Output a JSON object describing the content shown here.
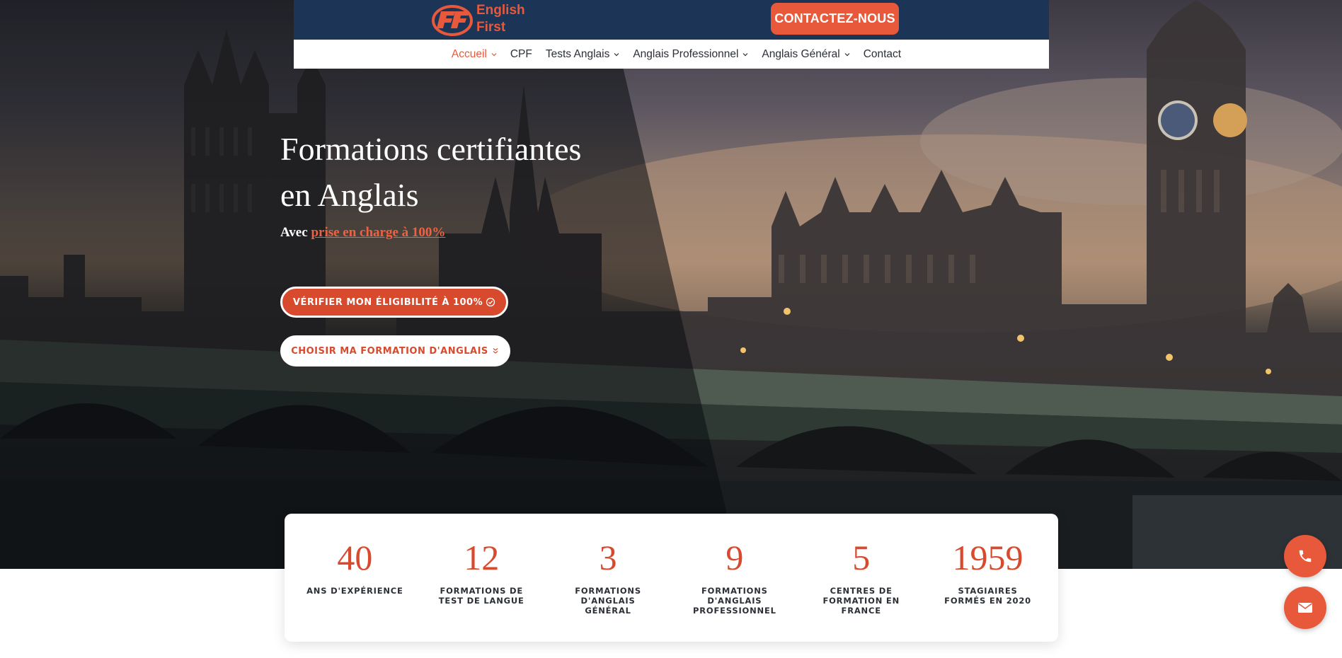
{
  "header": {
    "logo_line1": "English",
    "logo_line2": "First",
    "contact_button": "CONTACTEZ-NOUS"
  },
  "nav": {
    "items": [
      {
        "label": "Accueil",
        "dropdown": true,
        "active": true
      },
      {
        "label": "CPF",
        "dropdown": false
      },
      {
        "label": "Tests Anglais",
        "dropdown": true
      },
      {
        "label": "Anglais Professionnel",
        "dropdown": true
      },
      {
        "label": "Anglais Général",
        "dropdown": true
      },
      {
        "label": "Contact",
        "dropdown": false
      }
    ]
  },
  "hero": {
    "title_line1": "Formations certifiantes",
    "title_line2": "en Anglais",
    "subtitle_prefix": "Avec",
    "subtitle_link": "prise en charge à 100%",
    "cta_primary": "VÉRIFIER MON ÉLIGIBILITÉ À 100%",
    "cta_primary_icon": "check-circle-icon",
    "cta_secondary": "CHOISIR MA FORMATION D'ANGLAIS",
    "cta_secondary_icon": "double-chevron-down-icon"
  },
  "stats": [
    {
      "number": "40",
      "label_lines": [
        "ANS D'EXPÉRIENCE"
      ]
    },
    {
      "number": "12",
      "label_lines": [
        "FORMATIONS DE",
        "TEST DE LANGUE"
      ]
    },
    {
      "number": "3",
      "label_lines": [
        "FORMATIONS",
        "D'ANGLAIS",
        "GÉNÉRAL"
      ]
    },
    {
      "number": "9",
      "label_lines": [
        "FORMATIONS",
        "D'ANGLAIS",
        "PROFESSIONNEL"
      ]
    },
    {
      "number": "5",
      "label_lines": [
        "CENTRES DE",
        "FORMATION EN",
        "FRANCE"
      ]
    },
    {
      "number": "1959",
      "label_lines": [
        "STAGIAIRES",
        "FORMÉS EN 2020"
      ]
    }
  ],
  "floating": {
    "phone_icon": "phone-icon",
    "mail_icon": "envelope-icon"
  },
  "colors": {
    "accent": "#e8583a",
    "accent_dark": "#d74a2d",
    "header_bg": "#1c3557",
    "text_dark": "#2b2f36"
  }
}
